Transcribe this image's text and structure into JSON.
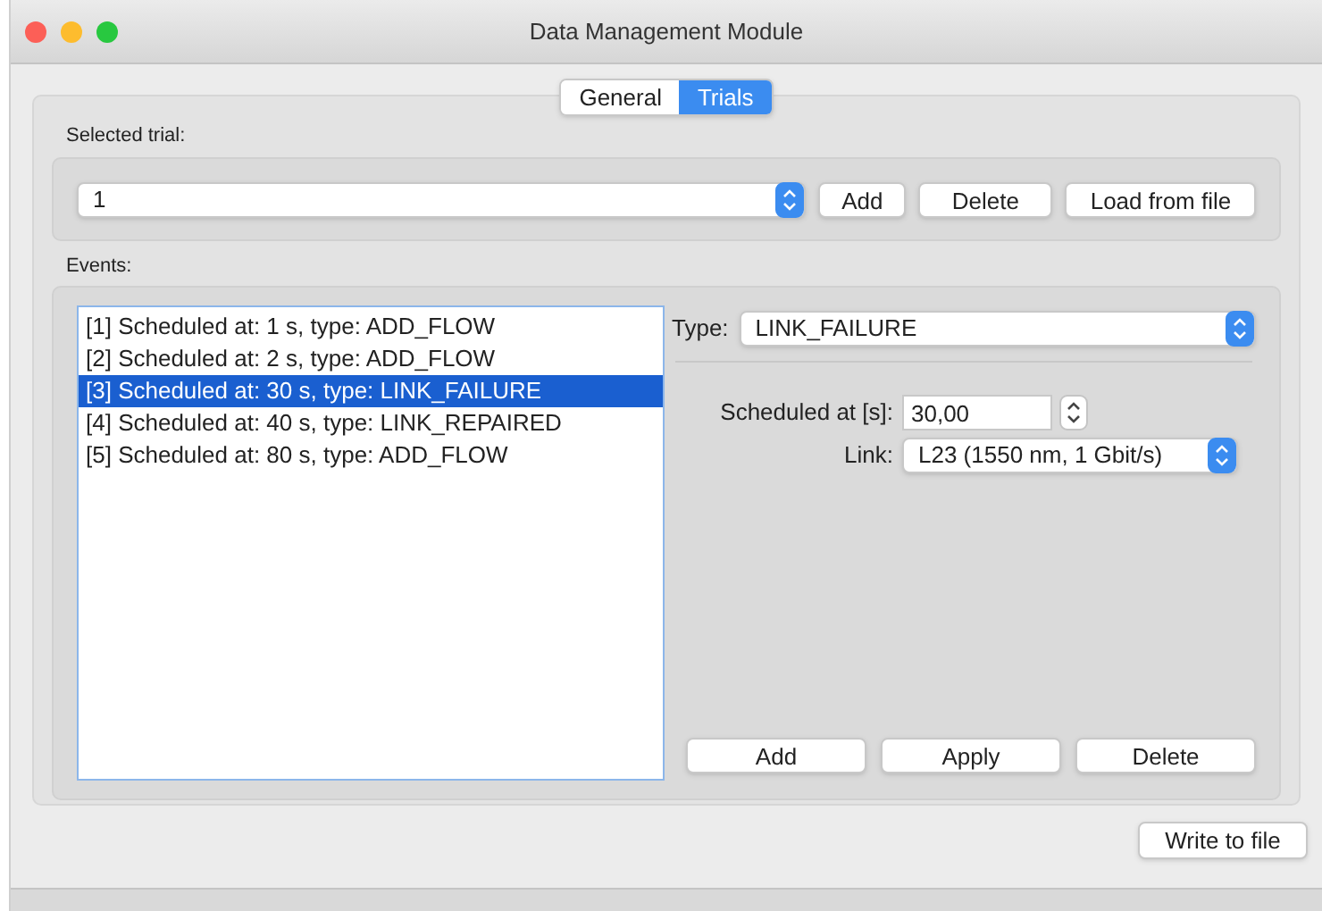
{
  "window": {
    "title": "Data Management Module"
  },
  "tabs": [
    {
      "label": "General",
      "selected": false
    },
    {
      "label": "Trials",
      "selected": true
    }
  ],
  "selected_trial": {
    "label": "Selected trial:",
    "value": "1",
    "buttons": [
      "Add",
      "Delete",
      "Load from file"
    ]
  },
  "events": {
    "label": "Events:",
    "items": [
      {
        "text": "[1] Scheduled at: 1 s, type: ADD_FLOW",
        "selected": false
      },
      {
        "text": "[2] Scheduled at: 2 s, type: ADD_FLOW",
        "selected": false
      },
      {
        "text": "[3] Scheduled at: 30 s, type: LINK_FAILURE",
        "selected": true
      },
      {
        "text": "[4] Scheduled at: 40 s, type: LINK_REPAIRED",
        "selected": false
      },
      {
        "text": "[5] Scheduled at: 80 s, type: ADD_FLOW",
        "selected": false
      }
    ],
    "type_label": "Type:",
    "type_value": "LINK_FAILURE",
    "scheduled_label": "Scheduled at [s]:",
    "scheduled_value": "30,00",
    "link_label": "Link:",
    "link_value": "L23 (1550 nm, 1 Gbit/s)",
    "buttons": [
      "Add",
      "Apply",
      "Delete"
    ]
  },
  "footer_button": "Write to file"
}
